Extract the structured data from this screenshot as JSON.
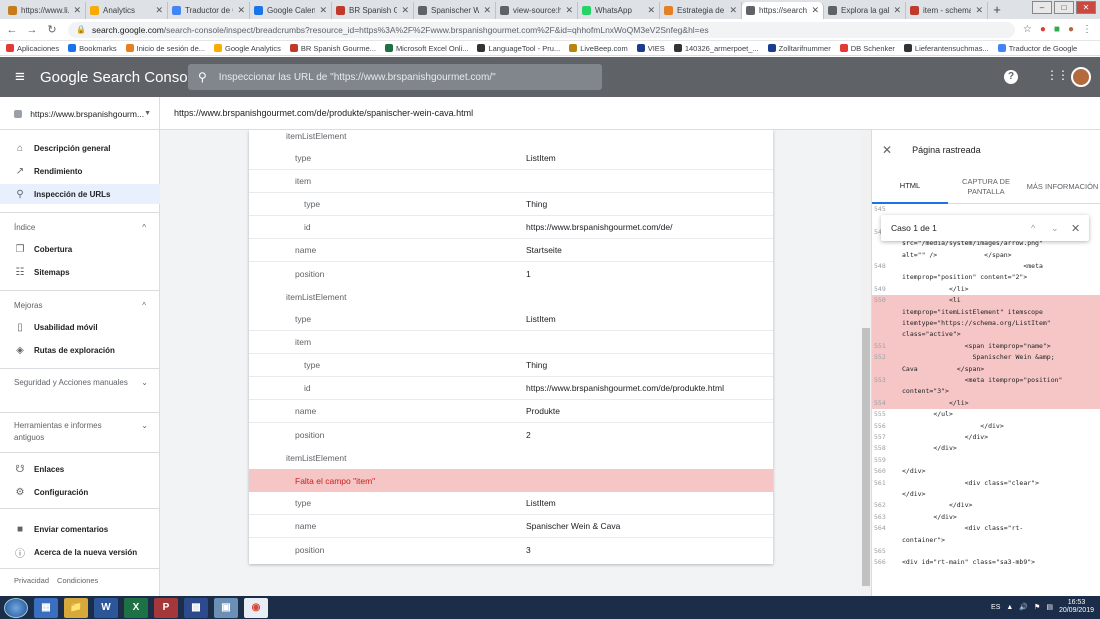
{
  "browser": {
    "tabs": [
      {
        "title": "https://www.li...",
        "color": "#c77b1a",
        "active": false
      },
      {
        "title": "Analytics",
        "color": "#f9ab00",
        "active": false
      },
      {
        "title": "Traductor de G",
        "color": "#4285f4",
        "active": false
      },
      {
        "title": "Google Calend...",
        "color": "#1a73e8",
        "active": false
      },
      {
        "title": "BR Spanish Go",
        "color": "#c0392b",
        "active": false
      },
      {
        "title": "Spanischer We",
        "color": "#5f6368",
        "active": false
      },
      {
        "title": "view-source:ht",
        "color": "#5f6368",
        "active": false
      },
      {
        "title": "WhatsApp",
        "color": "#25d366",
        "active": false
      },
      {
        "title": "Estrategia de c",
        "color": "#e67e22",
        "active": false
      },
      {
        "title": "https://search",
        "color": "#5f6368",
        "active": true
      },
      {
        "title": "Explora la gale",
        "color": "#5f6368",
        "active": false
      },
      {
        "title": "item - schema",
        "color": "#c0392b",
        "active": false
      }
    ],
    "url_host": "search.google.com",
    "url_path": "/search-console/inspect/breadcrumbs?resource_id=https%3A%2F%2Fwww.brspanishgourmet.com%2F&id=qhhofmLnxWoQM3eV2Snfeg&hl=es",
    "bookmarks": [
      {
        "label": "Aplicaciones",
        "color": "#e53935"
      },
      {
        "label": "Bookmarks",
        "color": "#1a73e8"
      },
      {
        "label": "Inicio de sesión de...",
        "color": "#e67e22"
      },
      {
        "label": "Google Analytics",
        "color": "#f9ab00"
      },
      {
        "label": "BR Spanish Gourme...",
        "color": "#c0392b"
      },
      {
        "label": "Microsoft Excel Onli...",
        "color": "#1e7145"
      },
      {
        "label": "LanguageTool - Pru...",
        "color": "#333"
      },
      {
        "label": "LiveBeep.com",
        "color": "#b8860b"
      },
      {
        "label": "VIES",
        "color": "#1a3d8f"
      },
      {
        "label": "140326_armerpoet_...",
        "color": "#333"
      },
      {
        "label": "Zolltarifnummer",
        "color": "#1a3d8f"
      },
      {
        "label": "DB Schenker",
        "color": "#e53935"
      },
      {
        "label": "Lieferantensuchmas...",
        "color": "#333"
      },
      {
        "label": "Traductor de Google",
        "color": "#4285f4"
      }
    ]
  },
  "header": {
    "app_name": "Google Search Console",
    "search_placeholder": "Inspeccionar las URL de \"https://www.brspanishgourmet.com/\""
  },
  "property": {
    "selected": "https://www.brspanishgourm...",
    "inspected_url": "https://www.brspanishgourmet.com/de/produkte/spanischer-wein-cava.html"
  },
  "sidebar": {
    "overview": "Descripción general",
    "performance": "Rendimiento",
    "url_inspection": "Inspección de URLs",
    "index_header": "Índice",
    "coverage": "Cobertura",
    "sitemaps": "Sitemaps",
    "enhancements_header": "Mejoras",
    "mobile_usability": "Usabilidad móvil",
    "breadcrumbs": "Rutas de exploración",
    "security_header": "Seguridad y Acciones manuales",
    "tools_header": "Herramientas e informes antiguos",
    "links": "Enlaces",
    "settings": "Configuración",
    "feedback": "Enviar comentarios",
    "about": "Acerca de la nueva versión",
    "privacy": "Privacidad",
    "terms": "Condiciones"
  },
  "details": {
    "rows": [
      {
        "key": "itemListElement",
        "value": "",
        "kind": "grp"
      },
      {
        "key": "type",
        "value": "ListItem",
        "kind": "b"
      },
      {
        "key": "item",
        "value": "",
        "kind": "b"
      },
      {
        "key": "type",
        "value": "Thing",
        "kind": "ind"
      },
      {
        "key": "id",
        "value": "https://www.brspanishgourmet.com/de/",
        "kind": "ind"
      },
      {
        "key": "name",
        "value": "Startseite",
        "kind": "b"
      },
      {
        "key": "position",
        "value": "1",
        "kind": ""
      },
      {
        "key": "itemListElement",
        "value": "",
        "kind": "grp"
      },
      {
        "key": "type",
        "value": "ListItem",
        "kind": "b"
      },
      {
        "key": "item",
        "value": "",
        "kind": "b"
      },
      {
        "key": "type",
        "value": "Thing",
        "kind": "ind"
      },
      {
        "key": "id",
        "value": "https://www.brspanishgourmet.com/de/produkte.html",
        "kind": "ind"
      },
      {
        "key": "name",
        "value": "Produkte",
        "kind": "b"
      },
      {
        "key": "position",
        "value": "2",
        "kind": ""
      },
      {
        "key": "itemListElement",
        "value": "",
        "kind": "grp"
      },
      {
        "key": "Falta el campo \"item\"",
        "value": "",
        "kind": "err"
      },
      {
        "key": "type",
        "value": "ListItem",
        "kind": "b"
      },
      {
        "key": "name",
        "value": "Spanischer Wein & Cava",
        "kind": "b"
      },
      {
        "key": "position",
        "value": "3",
        "kind": ""
      }
    ]
  },
  "panel": {
    "title": "Página rastreada",
    "tab_html": "HTML",
    "tab_screenshot": "CAPTURA DE PANTALLA",
    "tab_more": "MÁS INFORMACIÓN",
    "find_status": "Caso 1 de 1",
    "code": [
      {
        "n": "545",
        "t": "",
        "hl": false
      },
      {
        "n": "",
        "t": "",
        "hl": false
      },
      {
        "n": "547",
        "t": "                  <img\nsrc=\"/media/system/images/arrow.png\"\nalt=\"\" />            </span>",
        "hl": false
      },
      {
        "n": "548",
        "t": "                               <meta\nitemprop=\"position\" content=\"2\">",
        "hl": false
      },
      {
        "n": "549",
        "t": "            </li>",
        "hl": false
      },
      {
        "n": "550",
        "t": "            <li\nitemprop=\"itemListElement\" itemscope\nitemtype=\"https://schema.org/ListItem\"\nclass=\"active\">",
        "hl": true
      },
      {
        "n": "551",
        "t": "                <span itemprop=\"name\">",
        "hl": true
      },
      {
        "n": "552",
        "t": "                  Spanischer Wein &amp;\nCava          </span>",
        "hl": true
      },
      {
        "n": "553",
        "t": "                <meta itemprop=\"position\"\ncontent=\"3\">",
        "hl": true
      },
      {
        "n": "554",
        "t": "            </li>",
        "hl": true
      },
      {
        "n": "555",
        "t": "        </ul>",
        "hl": false
      },
      {
        "n": "556",
        "t": "                    </div>",
        "hl": false
      },
      {
        "n": "557",
        "t": "                </div>",
        "hl": false
      },
      {
        "n": "558",
        "t": "        </div>",
        "hl": false
      },
      {
        "n": "559",
        "t": "",
        "hl": false
      },
      {
        "n": "560",
        "t": "</div>",
        "hl": false
      },
      {
        "n": "561",
        "t": "                <div class=\"clear\">\n</div>",
        "hl": false
      },
      {
        "n": "562",
        "t": "            </div>",
        "hl": false
      },
      {
        "n": "563",
        "t": "        </div>",
        "hl": false
      },
      {
        "n": "564",
        "t": "                <div class=\"rt-\ncontainer\">",
        "hl": false
      },
      {
        "n": "565",
        "t": "",
        "hl": false
      },
      {
        "n": "566",
        "t": "<div id=\"rt-main\" class=\"sa3-mb9\">",
        "hl": false
      }
    ]
  },
  "taskbar": {
    "lang": "ES",
    "time": "16:53",
    "date": "20/09/2019"
  },
  "colors": {
    "header_bg": "#5f6368",
    "error_bg": "#f5c6c5",
    "error_text": "#c5221f",
    "selected_nav": "#e8f0fe"
  }
}
